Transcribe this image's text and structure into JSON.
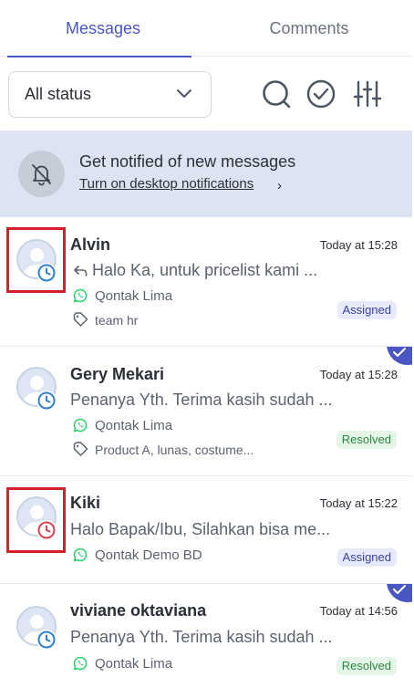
{
  "tabs": [
    {
      "label": "Messages",
      "active": true
    },
    {
      "label": "Comments",
      "active": false
    }
  ],
  "filter": {
    "status_value": "All status",
    "icons": [
      "search-icon",
      "check-circle-icon",
      "sliders-icon"
    ]
  },
  "notification": {
    "title": "Get notified of new messages",
    "link": "Turn on desktop notifications",
    "arrow": "›",
    "icon": "bell-off-icon"
  },
  "conversations": [
    {
      "name": "Alvin",
      "time": "Today at 15:28",
      "preview": "Halo Ka, untuk pricelist kami ...",
      "channel": "Qontak Lima",
      "tags": "team hr",
      "badge": "Assigned"
    },
    {
      "name": "Gery Mekari",
      "time": "Today at 15:28",
      "preview": "Penanya Yth. Terima kasih sudah ...",
      "channel": "Qontak Lima",
      "tags": "Product A, lunas, costume...",
      "badge": "Resolved"
    },
    {
      "name": "Kiki",
      "time": "Today at 15:22",
      "preview": "Halo Bapak/Ibu, Silahkan bisa me...",
      "channel": "Qontak Demo BD",
      "badge": "Assigned"
    },
    {
      "name": "viviane oktaviana",
      "time": "Today at 14:56",
      "preview": "Penanya Yth. Terima kasih sudah ...",
      "channel": "Qontak Lima",
      "badge": "Resolved"
    }
  ],
  "colors": {
    "accent": "#4a56c4",
    "clock_blue": "#2f7fd0",
    "clock_red": "#d6454f",
    "whatsapp": "#25d366",
    "highlight": "#d4202a"
  }
}
